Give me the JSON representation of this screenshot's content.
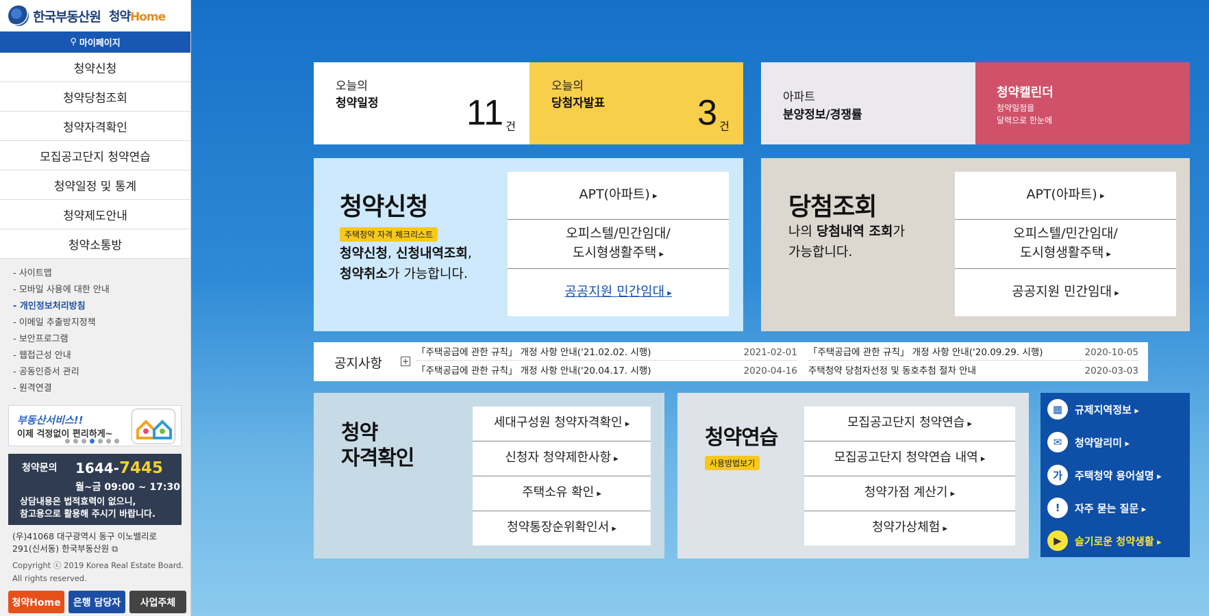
{
  "logo": {
    "main": "한국부동산원",
    "sub": "청약",
    "sub_en": "Home"
  },
  "sidebar": {
    "mypage": "마이페이지",
    "nav": [
      "청약신청",
      "청약당첨조회",
      "청약자격확인",
      "모집공고단지 청약연습",
      "청약일정 및 통계",
      "청약제도안내",
      "청약소통방"
    ],
    "links": [
      "- 사이트맵",
      "- 모바일 사용에 대한 안내",
      "- 개인정보처리방침",
      "- 이메일 추출방지정책",
      "- 보안프로그램",
      "- 웹접근성 안내",
      "- 공동인증서 관리",
      "- 원격연결"
    ],
    "banner": {
      "title": "부동산서비스!!",
      "sub": "이제 걱정없이 편리하게~"
    },
    "contact": {
      "label": "청약문의",
      "phone_prefix": "1644-",
      "phone_suffix": "7445",
      "hours": "월~금 09:00 ~ 17:30",
      "note1": "상담내용은 법적효력이 없으니,",
      "note2": "참고용으로 활용해 주시기 바랍니다."
    },
    "address1": "(우)41068 대구광역시 동구 이노밸리로",
    "address2": "291(신서동) 한국부동산원",
    "copyright1": "Copyright ⓒ 2019 Korea Real Estate Board.",
    "copyright2": "All rights reserved.",
    "buttons": [
      "청약Home",
      "은행 담당자",
      "사업주체"
    ]
  },
  "stats": {
    "today_schedule": {
      "label1": "오늘의",
      "label2": "청약일정",
      "count": "11",
      "unit": "건"
    },
    "today_winner": {
      "label1": "오늘의",
      "label2": "당첨자발표",
      "count": "3",
      "unit": "건"
    },
    "apt": {
      "label1": "아파트",
      "label2": "분양정보/경쟁률"
    },
    "calendar": {
      "title": "청약캘린더",
      "sub1": "청약일정을",
      "sub2": "달력으로 한눈에"
    }
  },
  "apply": {
    "title": "청약신청",
    "tag": "주택청약 자격 체크리스트",
    "desc_b1": "청약신청",
    "desc_n1": ", ",
    "desc_b2": "신청내역조회",
    "desc_n2": ",",
    "desc_b3": "청약취소",
    "desc_n3": "가 가능합니다.",
    "links": [
      "APT(아파트)",
      "오피스텔/민간임대/",
      "도시형생활주택",
      "공공지원 민간임대"
    ]
  },
  "winner": {
    "title": "당첨조회",
    "desc_n1": "나의 ",
    "desc_b1": "당첨내역 조회",
    "desc_n2": "가",
    "desc_n3": "가능합니다.",
    "links": [
      "APT(아파트)",
      "오피스텔/민간임대/",
      "도시형생활주택",
      "공공지원 민간임대"
    ]
  },
  "notice": {
    "title": "공지사항",
    "plus": "+",
    "items": [
      {
        "title": "「주택공급에 관한 규칙」 개정 사항 안내('21.02.02. 시행)",
        "date": "2021-02-01"
      },
      {
        "title": "「주택공급에 관한 규칙」 개정 사항 안내('20.09.29. 시행)",
        "date": "2020-10-05"
      },
      {
        "title": "「주택공급에 관한 규칙」 개정 사항 안내('20.04.17. 시행)",
        "date": "2020-04-16"
      },
      {
        "title": "주택청약 당첨자선정 및 동호추첨 절차 안내",
        "date": "2020-03-03"
      }
    ]
  },
  "eligibility": {
    "title1": "청약",
    "title2": "자격확인",
    "links": [
      "세대구성원 청약자격확인",
      "신청자 청약제한사항",
      "주택소유 확인",
      "청약통장순위확인서"
    ]
  },
  "practice": {
    "title": "청약연습",
    "tag": "사용방법보기",
    "links": [
      "모집공고단지 청약연습",
      "모집공고단지 청약연습 내역",
      "청약가점 계산기",
      "청약가상체험"
    ]
  },
  "quick": [
    {
      "icon": "▦",
      "label": "규제지역정보"
    },
    {
      "icon": "✉",
      "label": "청약알리미"
    },
    {
      "icon": "가",
      "label": "주택청약 용어설명"
    },
    {
      "icon": "!",
      "label": "자주 묻는 질문"
    },
    {
      "icon": "▶",
      "label": "슬기로운 청약생활"
    }
  ],
  "colors": {
    "sidebar_accent": "#1858b3",
    "yellow": "#f8cf4a",
    "pink": "#d0516a",
    "quick_bg": "#0e4fa8"
  }
}
